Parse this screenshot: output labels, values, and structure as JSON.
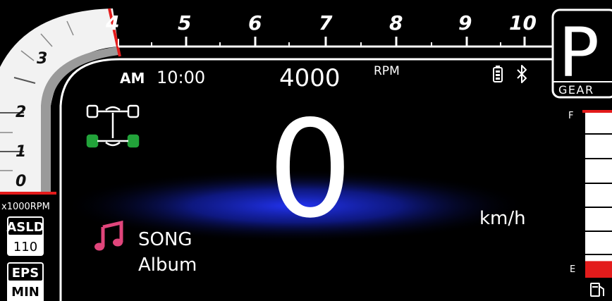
{
  "tachometer": {
    "top_scale_labels": [
      "4",
      "5",
      "6",
      "7",
      "8",
      "9",
      "10"
    ],
    "left_scale_labels": [
      "3",
      "2",
      "1",
      "0"
    ],
    "unit": "x1000RPM"
  },
  "status_bar": {
    "period": "AM",
    "time": "10:00",
    "rpm_value": "4000",
    "rpm_unit": "RPM",
    "battery_icon": "battery-icon",
    "bluetooth_icon": "bluetooth-icon"
  },
  "gear": {
    "value": "P",
    "label": "GEAR"
  },
  "speed": {
    "value": "0",
    "unit": "km/h"
  },
  "media": {
    "icon": "music-note-icon",
    "song": "SONG",
    "album": "Album"
  },
  "indicators": {
    "drivetrain_icon": "4wd-drivetrain-icon",
    "asld": {
      "label": "ASLD",
      "value": "110"
    },
    "eps": {
      "label": "EPS",
      "value": "MIN"
    }
  },
  "fuel": {
    "full_label": "F",
    "empty_label": "E",
    "icon": "fuel-pump-icon",
    "level": 0.1
  },
  "colors": {
    "background": "#000000",
    "redline": "#e31b1b",
    "speed_glow": "#1b2be0",
    "music_accent": "#e0457b",
    "drivetrain_green": "#22a33a"
  }
}
